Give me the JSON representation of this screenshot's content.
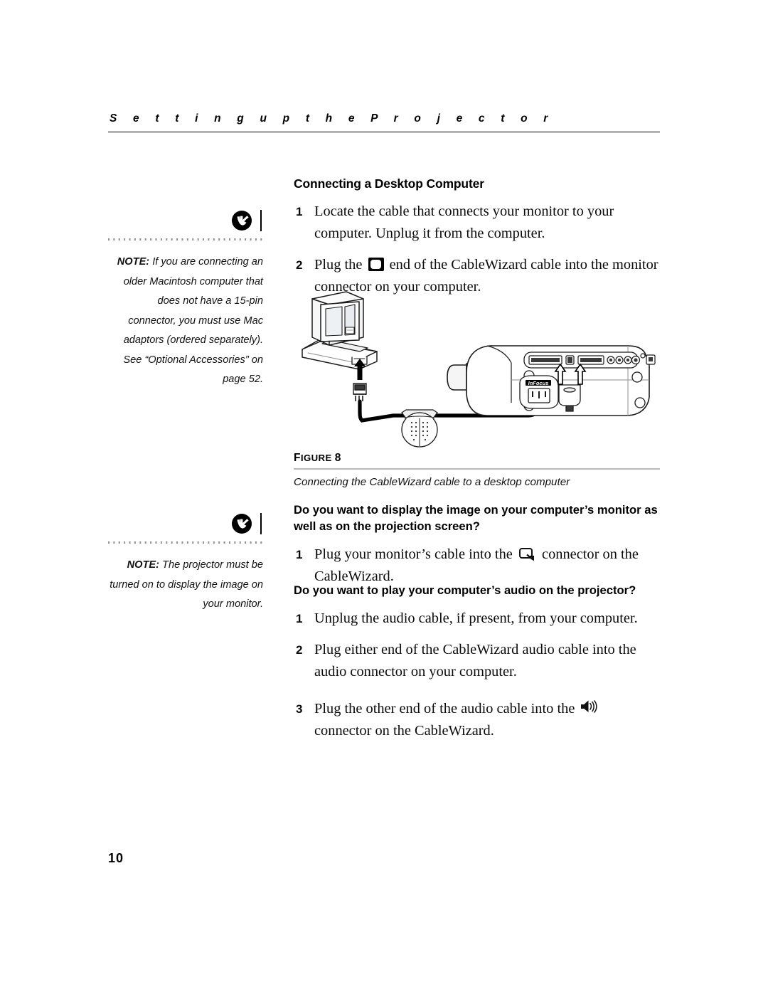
{
  "header": {
    "title": "S e t t i n g      u p      t h e      P r o j e c t o r"
  },
  "sidebar": {
    "notes": [
      {
        "logo": "infocus-logo-icon",
        "label": "NOTE:",
        "text": " If you are connecting an older Macintosh computer that does not have a 15-pin connector, you must use Mac adaptors (ordered separately). See “Optional Accessories” on page 52."
      },
      {
        "logo": "infocus-logo-icon",
        "label": "NOTE:",
        "text": " The projector must be turned on to display the image on your monitor."
      }
    ]
  },
  "main": {
    "section_heading": "Connecting a Desktop Computer",
    "steps_desktop": [
      {
        "num": "1",
        "text_before": "Locate the cable that connects your monitor to your computer. Unplug it from the computer.",
        "icon": "",
        "text_after": ""
      },
      {
        "num": "2",
        "text_before": "Plug the ",
        "icon": "monitor-icon",
        "text_after": " end of the CableWizard cable into the monitor connector on your computer."
      }
    ],
    "figure": {
      "label_prefix": "F",
      "label_rest": "IGURE",
      "number": "8",
      "caption": "Connecting the CableWizard cable to a desktop computer",
      "art_name": "desktop-computer-to-projector-cable-diagram"
    },
    "question_monitor": "Do you want to display the image on your computer’s monitor as well as on the projection screen?",
    "steps_monitor": [
      {
        "num": "1",
        "text_before": "Plug your monitor’s cable into the ",
        "icon": "monitor-out-icon",
        "text_after": " connector on the CableWizard."
      }
    ],
    "question_audio": "Do you want to play your computer’s audio on the projector?",
    "steps_audio": [
      {
        "num": "1",
        "text_before": "Unplug the audio cable, if present, from your computer.",
        "icon": "",
        "text_after": ""
      },
      {
        "num": "2",
        "text_before": "Plug either end of the CableWizard audio cable into the audio connector on your computer.",
        "icon": "",
        "text_after": ""
      },
      {
        "num": "3",
        "text_before": "Plug the other end of the audio cable into the ",
        "icon": "speaker-icon",
        "text_after": " connector on the CableWizard."
      }
    ]
  },
  "footer": {
    "page_number": "10"
  },
  "colors": {
    "text": "#000000",
    "figure_rule": "#b9b9b9",
    "dots": "#8a8a8a"
  }
}
